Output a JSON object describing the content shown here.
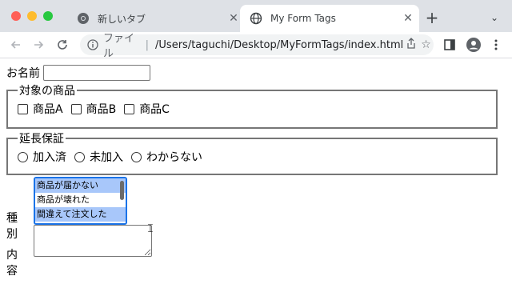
{
  "browser": {
    "tabs": [
      {
        "title": "新しいタブ",
        "active": false,
        "icon": "chrome-icon"
      },
      {
        "title": "My Form Tags",
        "active": true,
        "icon": "globe-icon"
      }
    ],
    "new_tab": "+",
    "tab_menu": "⌄",
    "address": {
      "scheme_label": "ファイル",
      "separator": "|",
      "url": "/Users/taguchi/Desktop/MyFormTags/index.html"
    }
  },
  "form": {
    "name_label": "お名前",
    "name_value": "",
    "products": {
      "legend": "対象の商品",
      "options": [
        "商品A",
        "商品B",
        "商品C"
      ]
    },
    "warranty": {
      "legend": "延長保証",
      "options": [
        "加入済",
        "未加入",
        "わからない"
      ]
    },
    "type_label": "種別",
    "type_options": [
      "商品が届かない",
      "商品が壊れた",
      "間違えて注文した"
    ],
    "type_selected": [
      "商品が届かない",
      "間違えて注文した"
    ],
    "content_label": "内容",
    "content_value": ""
  },
  "colors": {
    "accent": "#1a73e8",
    "selection": "#a8c7fa",
    "close": "#ff5f57",
    "minimize": "#febc2e",
    "zoom": "#28c840"
  }
}
